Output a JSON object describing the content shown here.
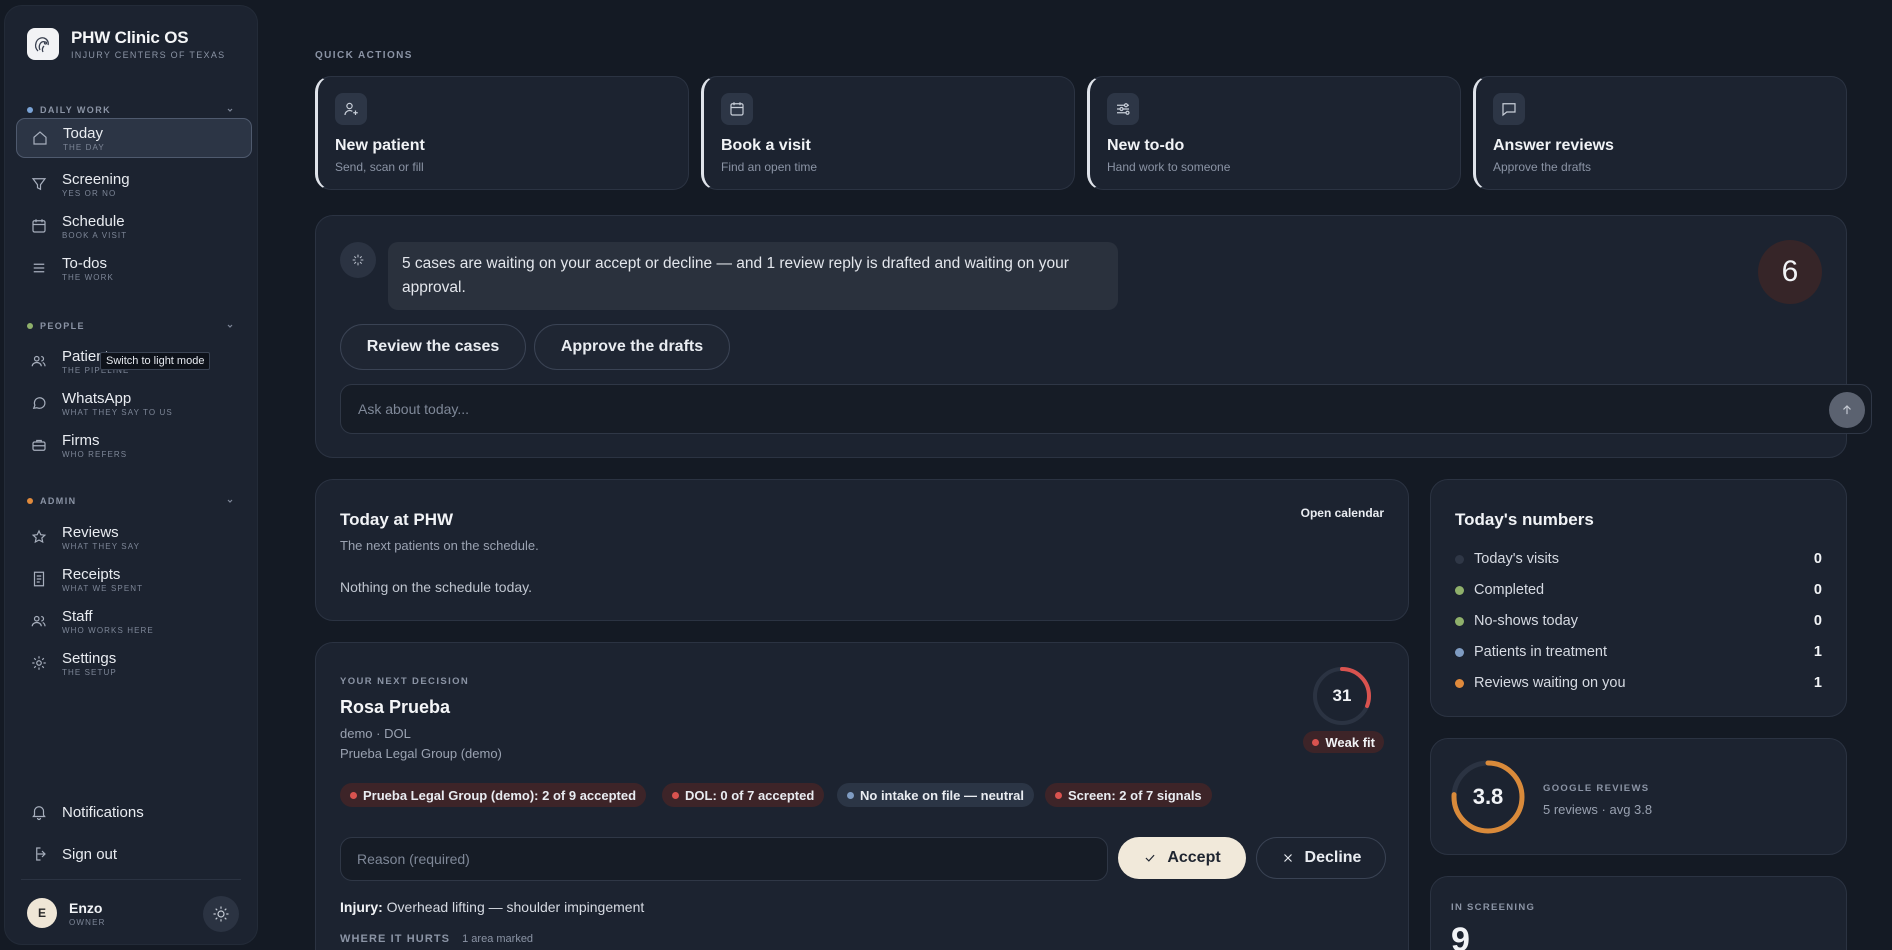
{
  "brand": {
    "name": "PHW Clinic OS",
    "subtitle": "INJURY CENTERS OF TEXAS"
  },
  "sidebar": {
    "sections": [
      {
        "label": "DAILY WORK",
        "dot_color": "#7aa3d6"
      },
      {
        "label": "PEOPLE",
        "dot_color": "#8fb06b"
      },
      {
        "label": "ADMIN",
        "dot_color": "#e08a3c"
      }
    ],
    "items": [
      {
        "label": "Today",
        "sub": "THE DAY",
        "icon": "home-icon"
      },
      {
        "label": "Screening",
        "sub": "YES OR NO",
        "icon": "filter-icon"
      },
      {
        "label": "Schedule",
        "sub": "BOOK A VISIT",
        "icon": "calendar-icon"
      },
      {
        "label": "To-dos",
        "sub": "THE WORK",
        "icon": "list-icon"
      },
      {
        "label": "Patients",
        "sub": "THE PIPELINE",
        "icon": "users-icon"
      },
      {
        "label": "WhatsApp",
        "sub": "WHAT THEY SAY TO US",
        "icon": "chat-icon"
      },
      {
        "label": "Firms",
        "sub": "WHO REFERS",
        "icon": "briefcase-icon"
      },
      {
        "label": "Reviews",
        "sub": "WHAT THEY SAY",
        "icon": "star-icon"
      },
      {
        "label": "Receipts",
        "sub": "WHAT WE SPENT",
        "icon": "receipt-icon"
      },
      {
        "label": "Staff",
        "sub": "WHO WORKS HERE",
        "icon": "users-icon"
      },
      {
        "label": "Settings",
        "sub": "THE SETUP",
        "icon": "gear-icon"
      }
    ],
    "tooltip": "Switch to light mode",
    "bottom": {
      "notifications": "Notifications",
      "sign_out": "Sign out"
    },
    "user": {
      "initial": "E",
      "name": "Enzo",
      "role": "OWNER"
    }
  },
  "quick_actions": {
    "title": "QUICK ACTIONS",
    "items": [
      {
        "label": "New patient",
        "sub": "Send, scan or fill",
        "icon": "user-plus-icon"
      },
      {
        "label": "Book a visit",
        "sub": "Find an open time",
        "icon": "calendar-icon"
      },
      {
        "label": "New to-do",
        "sub": "Hand work to someone",
        "icon": "sliders-icon"
      },
      {
        "label": "Answer reviews",
        "sub": "Approve the drafts",
        "icon": "message-icon"
      }
    ]
  },
  "assistant": {
    "message": "5 cases are waiting on your accept or decline — and 1 review reply is drafted and waiting on your approval.",
    "count": "6",
    "buttons": {
      "review_cases": "Review the cases",
      "approve_drafts": "Approve the drafts"
    },
    "ask_placeholder": "Ask about today..."
  },
  "today": {
    "title": "Today at PHW",
    "subtitle": "The next patients on the schedule.",
    "empty": "Nothing on the schedule today.",
    "open_calendar": "Open calendar"
  },
  "numbers": {
    "title": "Today's numbers",
    "rows": [
      {
        "label": "Today's visits",
        "value": "0",
        "color": "#2f3746"
      },
      {
        "label": "Completed",
        "value": "0",
        "color": "#8fb06b"
      },
      {
        "label": "No-shows today",
        "value": "0",
        "color": "#8fb06b"
      },
      {
        "label": "Patients in treatment",
        "value": "1",
        "color": "#7f9cc2"
      },
      {
        "label": "Reviews waiting on you",
        "value": "1",
        "color": "#e08a3c"
      }
    ]
  },
  "google": {
    "rating": "3.8",
    "rating_fraction": 0.76,
    "label": "GOOGLE REVIEWS",
    "summary": "5 reviews · avg 3.8",
    "accent": "#d98a3a"
  },
  "screening": {
    "label": "IN SCREENING",
    "value": "9"
  },
  "decision": {
    "eyebrow": "YOUR NEXT DECISION",
    "name": "Rosa Prueba",
    "meta": "demo · DOL",
    "firm": "Prueba Legal Group (demo)",
    "score": "31",
    "score_fraction": 0.31,
    "score_color": "#d9534f",
    "fit": "Weak fit",
    "chips": [
      {
        "text": "Prueba Legal Group (demo): 2 of 9 accepted",
        "tone": "red"
      },
      {
        "text": "DOL: 0 of 7 accepted",
        "tone": "red"
      },
      {
        "text": "No intake on file — neutral",
        "tone": "blue"
      },
      {
        "text": "Screen: 2 of 7 signals",
        "tone": "red"
      }
    ],
    "reason_placeholder": "Reason (required)",
    "accept": "Accept",
    "decline": "Decline",
    "injury_label": "Injury:",
    "injury": "Overhead lifting — shoulder impingement",
    "where_label": "WHERE IT HURTS",
    "where_count": "1 area marked"
  }
}
